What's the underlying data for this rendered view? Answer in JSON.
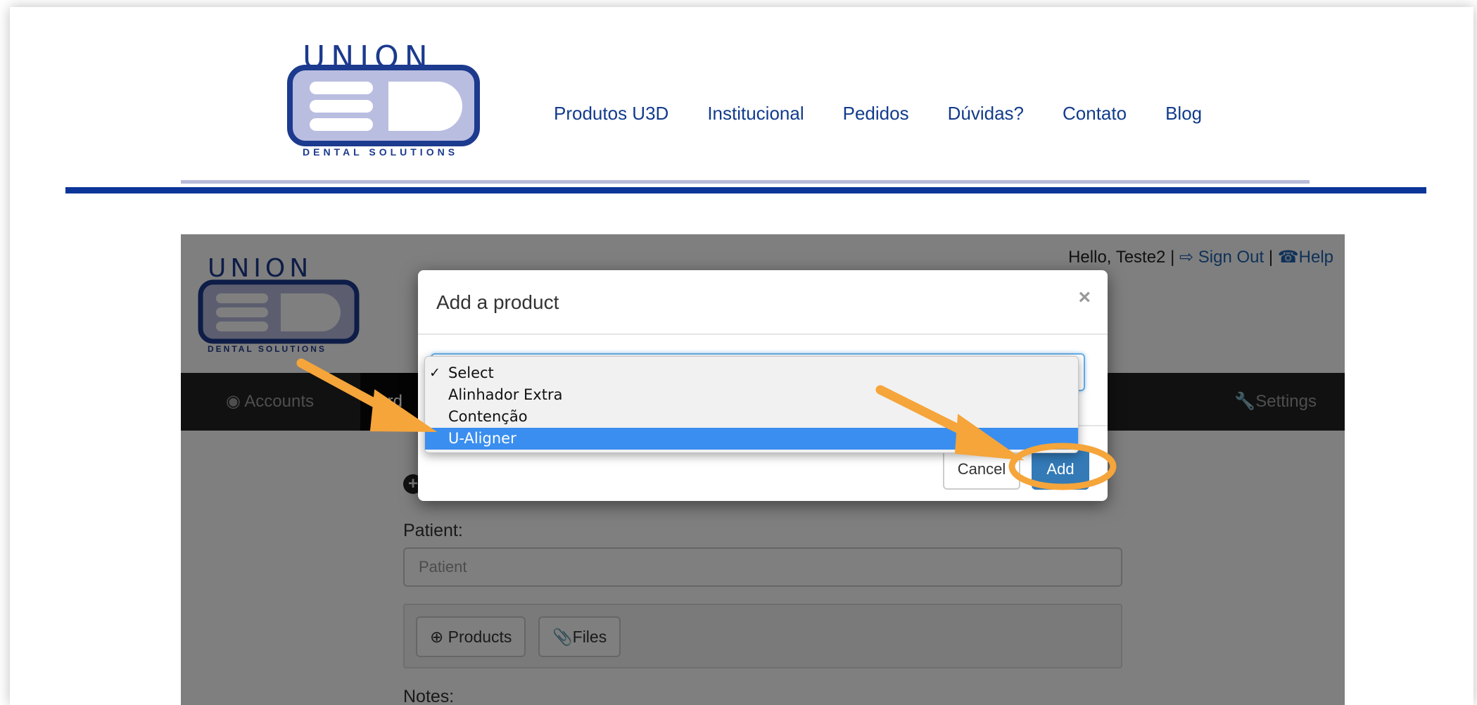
{
  "site": {
    "logo_union": "UNION",
    "logo_tagline": "DENTAL SOLUTIONS",
    "nav": [
      "Produtos U3D",
      "Institucional",
      "Pedidos",
      "Dúvidas?",
      "Contato",
      "Blog"
    ]
  },
  "app": {
    "logo_union": "UNION",
    "logo_tagline": "DENTAL SOLUTIONS",
    "greeting": "Hello, Teste2",
    "sign_out": "Sign Out",
    "help": "Help",
    "tabs": {
      "accounts": "Accounts",
      "orders": "Ord",
      "settings": "Settings"
    },
    "patient_label": "Patient:",
    "patient_placeholder": "Patient",
    "products_button": "Products",
    "files_button": "Files",
    "notes_label": "Notes:"
  },
  "modal": {
    "title": "Add a product",
    "close": "×",
    "options": [
      "Select",
      "Alinhador Extra",
      "Contenção",
      "U-Aligner"
    ],
    "checked_option": "Select",
    "highlighted_option": "U-Aligner",
    "cancel": "Cancel",
    "add": "Add"
  },
  "annotation_color": "#f5a53a"
}
